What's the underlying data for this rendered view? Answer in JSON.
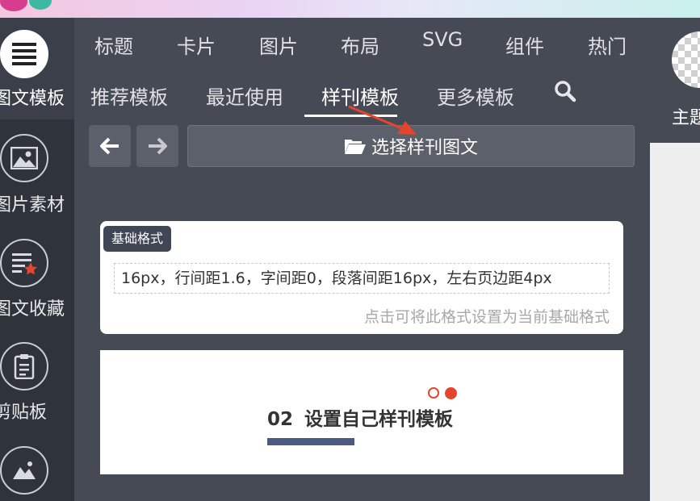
{
  "nav": {
    "row1": [
      "标题",
      "卡片",
      "图片",
      "布局",
      "SVG",
      "组件",
      "热门"
    ],
    "row2": [
      "推荐模板",
      "最近使用",
      "样刊模板",
      "更多模板"
    ],
    "active_tab": "样刊模板"
  },
  "sidebar": {
    "items": [
      {
        "label": "图文模板",
        "icon": "list-icon"
      },
      {
        "label": "图片素材",
        "icon": "image-icon"
      },
      {
        "label": "图文收藏",
        "icon": "star-document-icon"
      },
      {
        "label": "剪贴板",
        "icon": "clipboard-icon"
      },
      {
        "label": "",
        "icon": "picture-icon"
      }
    ]
  },
  "header_right": {
    "theme_label": "主题"
  },
  "toolbar": {
    "select_label": "选择样刊图文"
  },
  "format_card": {
    "badge": "基础格式",
    "format_text": "16px，行间距1.6，字间距0，段落间距16px，左右页边距4px",
    "hint": "点击可将此格式设置为当前基础格式"
  },
  "template_preview": {
    "number": "02",
    "title": "设置自己样刊模板"
  },
  "colors": {
    "accent_red": "#e5452d",
    "bar_blue": "#4b5a80",
    "panel": "#454a55"
  }
}
